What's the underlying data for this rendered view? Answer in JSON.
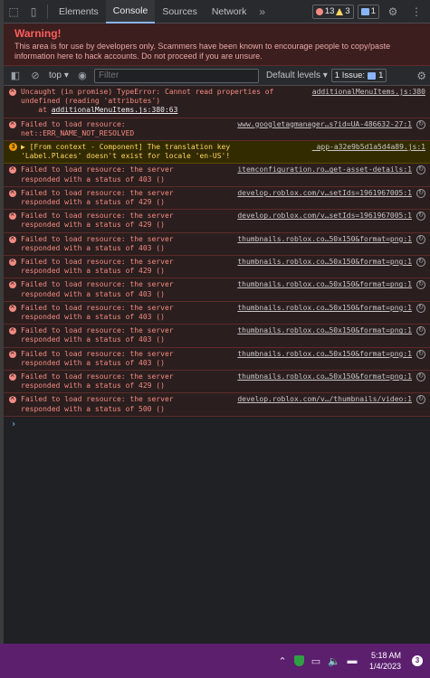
{
  "tabbar": {
    "tabs": [
      {
        "label": "Elements"
      },
      {
        "label": "Console"
      },
      {
        "label": "Sources"
      },
      {
        "label": "Network"
      }
    ],
    "more": "»",
    "errors_count": "13",
    "warnings_count": "3",
    "info_count": "1"
  },
  "warning": {
    "title": "Warning!",
    "text": "This area is for use by developers only. Scammers have been known to encourage people to copy/paste information here to hack accounts. Do not proceed if you are unsure."
  },
  "toolbar": {
    "context": "top",
    "filter_placeholder": "Filter",
    "levels": "Default levels",
    "issues_label": "1 Issue:",
    "issues_count": "1"
  },
  "messages": [
    {
      "type": "error",
      "lines": [
        "Uncaught (in promise) TypeError: Cannot read properties of",
        "undefined (reading 'attributes')"
      ],
      "stack_prefix": "    at ",
      "stack_link": "additionalMenuItems.js:380:63",
      "source": "additionalMenuItems.js:380"
    },
    {
      "type": "error",
      "lines": [
        "Failed to load resource:",
        "net::ERR_NAME_NOT_RESOLVED"
      ],
      "source": "www.googletagmanager…s?id=UA-486632-27:1"
    },
    {
      "type": "warn",
      "badge": "3",
      "lines": [
        "▶ [From context - Component] The translation key",
        "'Label.Places' doesn't exist for locale 'en-US'!"
      ],
      "source": "_app-a32e9b5d1a5d4a89.js:1"
    },
    {
      "type": "error",
      "lines": [
        "Failed to load resource: the server",
        "responded with a status of 403 ()"
      ],
      "source": "itemconfiguration.ro…get-asset-details:1"
    },
    {
      "type": "error",
      "lines": [
        "Failed to load resource: the server",
        "responded with a status of 429 ()"
      ],
      "source": "develop.roblox.com/v…setIds=1961967005:1"
    },
    {
      "type": "error",
      "lines": [
        "Failed to load resource: the server",
        "responded with a status of 429 ()"
      ],
      "source": "develop.roblox.com/v…setIds=1961967005:1"
    },
    {
      "type": "error",
      "lines": [
        "Failed to load resource: the server",
        "responded with a status of 403 ()"
      ],
      "source": "thumbnails.roblox.co…50x150&format=png:1"
    },
    {
      "type": "error",
      "lines": [
        "Failed to load resource: the server",
        "responded with a status of 429 ()"
      ],
      "source": "thumbnails.roblox.co…50x150&format=png:1"
    },
    {
      "type": "error",
      "lines": [
        "Failed to load resource: the server",
        "responded with a status of 403 ()"
      ],
      "source": "thumbnails.roblox.co…50x150&format=png:1"
    },
    {
      "type": "error",
      "lines": [
        "Failed to load resource: the server",
        "responded with a status of 403 ()"
      ],
      "source": "thumbnails.roblox.co…50x150&format=png:1"
    },
    {
      "type": "error",
      "lines": [
        "Failed to load resource: the server",
        "responded with a status of 403 ()"
      ],
      "source": "thumbnails.roblox.co…50x150&format=png:1"
    },
    {
      "type": "error",
      "lines": [
        "Failed to load resource: the server",
        "responded with a status of 403 ()"
      ],
      "source": "thumbnails.roblox.co…50x150&format=png:1"
    },
    {
      "type": "error",
      "lines": [
        "Failed to load resource: the server",
        "responded with a status of 429 ()"
      ],
      "source": "thumbnails.roblox.co…50x150&format=png:1"
    },
    {
      "type": "error",
      "lines": [
        "Failed to load resource: the server",
        "responded with a status of 500 ()"
      ],
      "source": "develop.roblox.com/v…/thumbnails/video:1"
    }
  ],
  "prompt": "›",
  "taskbar": {
    "time": "5:18 AM",
    "date": "1/4/2023",
    "notifications": "3"
  },
  "colors": {
    "taskbar": "#5b1f6e",
    "error_text": "#f28b82",
    "warning_title": "#ff5d5d",
    "accent": "#8ab4f8"
  }
}
